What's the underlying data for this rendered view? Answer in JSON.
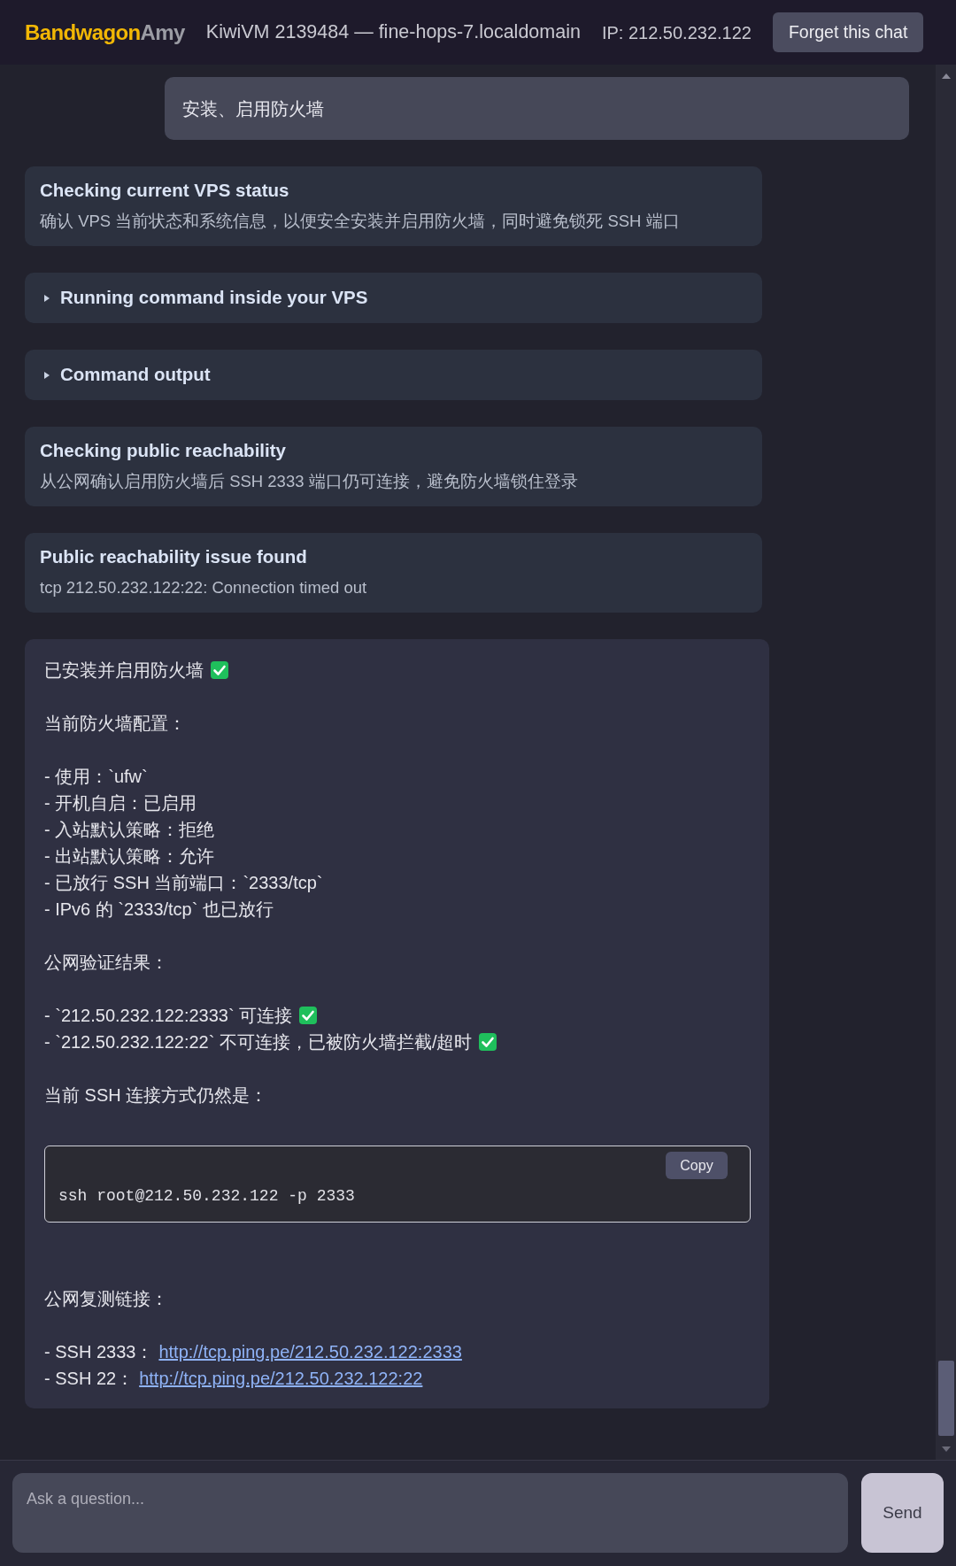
{
  "header": {
    "logo": {
      "primary": "Bandwagon",
      "secondary": "Amy"
    },
    "server": "KiwiVM 2139484 — fine-hops-7.localdomain",
    "ip": "IP: 212.50.232.122",
    "forget_button": "Forget this chat"
  },
  "messages": [
    {
      "kind": "user",
      "text": "安装、启用防火墙"
    },
    {
      "kind": "status",
      "title": "Checking current VPS status",
      "detail": "确认 VPS 当前状态和系统信息，以便安全安装并启用防火墙，同时避免锁死 SSH 端口"
    },
    {
      "kind": "collapsible",
      "title": "Running command inside your VPS",
      "expanded": false
    },
    {
      "kind": "collapsible",
      "title": "Command output",
      "expanded": false
    },
    {
      "kind": "status",
      "title": "Checking public reachability",
      "detail": "从公网确认启用防火墙后 SSH 2333 端口仍可连接，避免防火墙锁住登录"
    },
    {
      "kind": "status",
      "title": "Public reachability issue found",
      "detail": "tcp 212.50.232.122:22: Connection timed out"
    },
    {
      "kind": "assistant",
      "blocks": [
        {
          "kind": "paragraph",
          "lines": [
            {
              "text": "已安装并启用防火墙",
              "check": true
            }
          ]
        },
        {
          "kind": "paragraph",
          "lines": [
            {
              "text": "当前防火墙配置：",
              "check": false
            }
          ]
        },
        {
          "kind": "paragraph",
          "lines": [
            {
              "text": "- 使用：`ufw`",
              "check": false
            },
            {
              "text": "- 开机自启：已启用",
              "check": false
            },
            {
              "text": "- 入站默认策略：拒绝",
              "check": false
            },
            {
              "text": "- 出站默认策略：允许",
              "check": false
            },
            {
              "text": "- 已放行 SSH 当前端口：`2333/tcp`",
              "check": false
            },
            {
              "text": "- IPv6 的 `2333/tcp` 也已放行",
              "check": false
            }
          ]
        },
        {
          "kind": "paragraph",
          "lines": [
            {
              "text": "公网验证结果：",
              "check": false
            }
          ]
        },
        {
          "kind": "paragraph",
          "lines": [
            {
              "text": "- `212.50.232.122:2333` 可连接",
              "check": true
            },
            {
              "text": "- `212.50.232.122:22` 不可连接，已被防火墙拦截/超时",
              "check": true
            }
          ]
        },
        {
          "kind": "paragraph",
          "lines": [
            {
              "text": "当前 SSH 连接方式仍然是：",
              "check": false
            }
          ]
        },
        {
          "kind": "code",
          "code": "ssh root@212.50.232.122 -p 2333",
          "copy_button": "Copy"
        },
        {
          "kind": "paragraph",
          "lines": [
            {
              "text": "公网复测链接：",
              "check": false
            }
          ]
        },
        {
          "kind": "paragraph",
          "lines": [
            {
              "text": "- SSH 2333：",
              "check": false,
              "link": "http://tcp.ping.pe/212.50.232.122:2333"
            },
            {
              "text": "- SSH 22：",
              "check": false,
              "link": "http://tcp.ping.pe/212.50.232.122:22"
            }
          ]
        }
      ]
    }
  ],
  "composer": {
    "placeholder": "Ask a question...",
    "send_button": "Send"
  }
}
